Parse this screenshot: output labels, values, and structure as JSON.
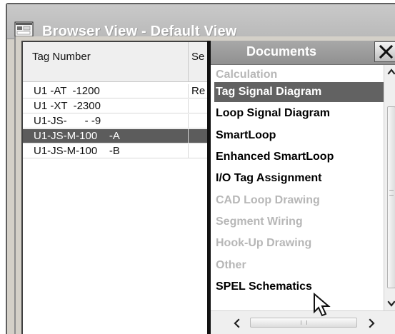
{
  "window": {
    "title": "Browser View - Default View",
    "title_icon": "browser-view-icon"
  },
  "grid": {
    "columns": [
      {
        "label": "Tag Number"
      },
      {
        "label": "Se"
      }
    ],
    "rows": [
      {
        "tag_number": "U1 -AT  -1200",
        "second_column": "Re",
        "selected": false
      },
      {
        "tag_number": "U1 -XT  -2300",
        "second_column": "",
        "selected": false
      },
      {
        "tag_number": "U1-JS-      - -9",
        "second_column": "",
        "selected": false
      },
      {
        "tag_number": "U1-JS-M-100    -A",
        "second_column": "",
        "selected": true
      },
      {
        "tag_number": "U1-JS-M-100    -B",
        "second_column": "",
        "selected": false
      }
    ]
  },
  "documents_menu": {
    "title": "Documents",
    "close_icon": "close-icon",
    "items": [
      {
        "label": "Calculation",
        "state": "disabled"
      },
      {
        "label": "Tag Signal Diagram",
        "state": "highlighted"
      },
      {
        "label": "Loop Signal Diagram",
        "state": "enabled"
      },
      {
        "label": "SmartLoop",
        "state": "enabled"
      },
      {
        "label": "Enhanced SmartLoop",
        "state": "enabled"
      },
      {
        "label": "I/O Tag Assignment",
        "state": "enabled"
      },
      {
        "label": "CAD Loop Drawing",
        "state": "disabled"
      },
      {
        "label": "Segment Wiring",
        "state": "disabled"
      },
      {
        "label": "Hook-Up Drawing",
        "state": "disabled"
      },
      {
        "label": "Other",
        "state": "disabled"
      },
      {
        "label": "SPEL Schematics",
        "state": "enabled"
      }
    ],
    "scrollbars": {
      "vertical": [
        "chevron-up-icon",
        "chevron-down-icon"
      ],
      "horizontal": [
        "chevron-left-icon",
        "chevron-right-icon"
      ]
    }
  },
  "cursor": {
    "icon": "mouse-pointer-icon"
  },
  "colors": {
    "title_bar": "#b9b9b9",
    "selected_row": "#5c5c5c",
    "highlighted_menu_item": "#626262",
    "disabled_text": "#b7b7b7",
    "menu_text": "#000000",
    "window_text": "#ffffff"
  }
}
